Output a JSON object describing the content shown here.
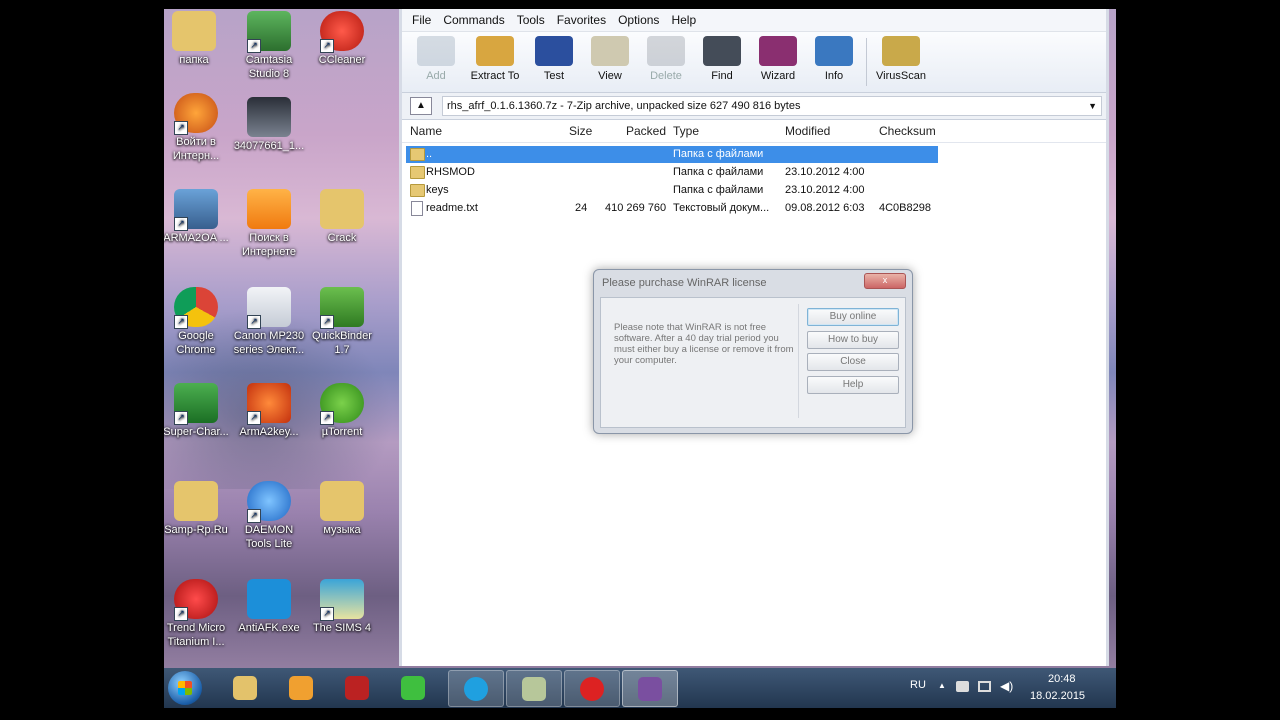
{
  "desktop": {
    "icons": [
      {
        "label": "папка"
      },
      {
        "label": "Camtasia Studio 8"
      },
      {
        "label": "CCleaner"
      },
      {
        "label": "Войти в Интерн..."
      },
      {
        "label": "34077661_1..."
      },
      {
        "label": "ARMA2OA ..."
      },
      {
        "label": "Поиск в Интернете"
      },
      {
        "label": "Crack"
      },
      {
        "label": "Google Chrome"
      },
      {
        "label": "Canon MP230 series Элект..."
      },
      {
        "label": "QuickBinder 1.7"
      },
      {
        "label": "Super-Char..."
      },
      {
        "label": "ArmA2key..."
      },
      {
        "label": "µTorrent"
      },
      {
        "label": "Samp-Rp.Ru"
      },
      {
        "label": "DAEMON Tools Lite"
      },
      {
        "label": "музыка"
      },
      {
        "label": "Trend Micro Titanium I..."
      },
      {
        "label": "AntiAFK.exe"
      },
      {
        "label": "The SIMS 4"
      }
    ]
  },
  "winrar": {
    "menu": [
      "File",
      "Commands",
      "Tools",
      "Favorites",
      "Options",
      "Help"
    ],
    "toolbar": [
      {
        "label": "Add",
        "disabled": true,
        "color": "#8fa0b3"
      },
      {
        "label": "Extract To",
        "disabled": false,
        "color": "#d8a640"
      },
      {
        "label": "Test",
        "disabled": false,
        "color": "#2b4f9e"
      },
      {
        "label": "View",
        "disabled": false,
        "color": "#cfc9b0"
      },
      {
        "label": "Delete",
        "disabled": true,
        "color": "#8a8f98"
      },
      {
        "label": "Find",
        "disabled": false,
        "color": "#444c58"
      },
      {
        "label": "Wizard",
        "disabled": false,
        "color": "#8a2f70"
      },
      {
        "label": "Info",
        "disabled": false,
        "color": "#3a78c0"
      },
      {
        "label": "VirusScan",
        "disabled": false,
        "color": "#c9a94a"
      }
    ],
    "path": "rhs_afrf_0.1.6.1360.7z - 7-Zip archive, unpacked size 627 490 816 bytes",
    "columns": [
      "Name",
      "Size",
      "Packed",
      "Type",
      "Modified",
      "Checksum"
    ],
    "rows": [
      {
        "name": "..",
        "size": "",
        "packed": "",
        "type": "Папка с файлами",
        "modified": "",
        "checksum": "",
        "kind": "folder",
        "selected": true
      },
      {
        "name": "RHSMOD",
        "size": "",
        "packed": "",
        "type": "Папка с файлами",
        "modified": "23.10.2012 4:00",
        "checksum": "",
        "kind": "folder",
        "selected": false
      },
      {
        "name": "keys",
        "size": "",
        "packed": "",
        "type": "Папка с файлами",
        "modified": "23.10.2012 4:00",
        "checksum": "",
        "kind": "folder",
        "selected": false
      },
      {
        "name": "readme.txt",
        "size": "24",
        "packed": "410 269 760",
        "type": "Текстовый докум...",
        "modified": "09.08.2012 6:03",
        "checksum": "4C0B8298",
        "kind": "file",
        "selected": false
      }
    ]
  },
  "dialog": {
    "title": "Please purchase WinRAR license",
    "close_label": "x",
    "text": "Please note that WinRAR is not free software. After a 40 day trial period you must either buy a license or remove it from your computer.",
    "buttons": [
      "Buy online",
      "How to buy",
      "Close",
      "Help"
    ]
  },
  "taskbar": {
    "apps": [
      {
        "name": "windows-explorer",
        "color": "#e3c26b"
      },
      {
        "name": "media-player",
        "color": "#f0a030"
      },
      {
        "name": "red-app",
        "color": "#b22"
      },
      {
        "name": "green-a-app",
        "color": "#3fbf3f"
      },
      {
        "name": "skype",
        "color": "#1fa0e0"
      },
      {
        "name": "notes-app",
        "color": "#b7c79a"
      },
      {
        "name": "recorder",
        "color": "#d22"
      },
      {
        "name": "winrar",
        "color": "#7a4fa0"
      }
    ],
    "lang": "RU",
    "time": "20:48",
    "date": "18.02.2015"
  }
}
